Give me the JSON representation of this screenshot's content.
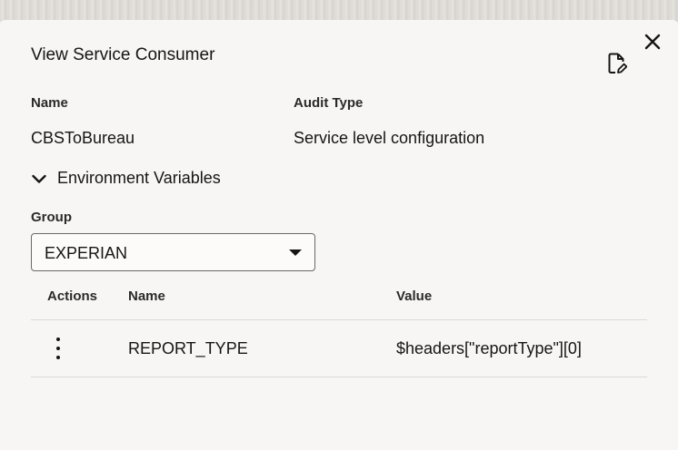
{
  "dialog": {
    "title": "View Service Consumer",
    "close_icon": "close-icon",
    "edit_icon": "edit-document-icon"
  },
  "fields": {
    "name_label": "Name",
    "name_value": "CBSToBureau",
    "audit_type_label": "Audit Type",
    "audit_type_value": "Service level configuration"
  },
  "environment": {
    "section_label": "Environment Variables",
    "expanded": true,
    "group_label": "Group",
    "group_selected": "EXPERIAN",
    "table": {
      "headers": [
        "Actions",
        "Name",
        "Value"
      ],
      "rows": [
        {
          "name": "REPORT_TYPE",
          "value": "$headers[\"reportType\"][0]"
        }
      ]
    }
  },
  "colors": {
    "background": "#f7f6f5",
    "text": "#161513",
    "border": "#6b6864",
    "divider": "#dcd9d6"
  }
}
